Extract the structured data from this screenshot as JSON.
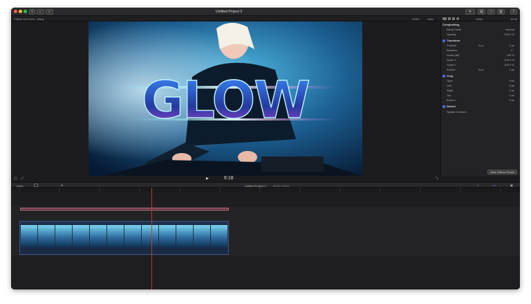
{
  "toolbar": {
    "project_title": "Untitled Project 3"
  },
  "subbar": {
    "library_label": "FINAL H.E.N.R.L. Shiny",
    "zoom": "143%",
    "view_label": "View",
    "inspector_tab": "Video",
    "inspector_right": "10:18"
  },
  "viewer": {
    "title_text": "GLOW"
  },
  "inspector": {
    "compositing": "Compositing",
    "blend_mode_label": "Blend Mode",
    "blend_mode_value": "Normal",
    "opacity_label": "Opacity",
    "opacity_value": "100.0 %",
    "transform": "Transform",
    "position_label": "Position",
    "position_x": "0 px",
    "position_y": "0 px",
    "rotation_label": "Rotation",
    "rotation_value": "0 °",
    "scale_all_label": "Scale (All)",
    "scale_all_value": "100 %",
    "scale_x_label": "Scale X",
    "scale_x_value": "100.0 %",
    "scale_y_label": "Scale Y",
    "scale_y_value": "100.0 %",
    "anchor_label": "Anchor",
    "anchor_x": "0 px",
    "anchor_y": "0 px",
    "crop": "Crop",
    "type_label": "Type",
    "type_value": "Trim",
    "left_label": "Left",
    "left_value": "0 px",
    "right_label": "Right",
    "right_value": "0 px",
    "top_label": "Top",
    "top_value": "0 px",
    "bottom_label": "Bottom",
    "bottom_value": "0 px",
    "distort": "Distort",
    "spatial_conform": "Spatial Conform",
    "save_preset": "Save Effects Preset"
  },
  "viewer_controls": {
    "timecode": "6:18"
  },
  "timeline_bar": {
    "index_label": "Index",
    "project_label": "Untitled Project 3",
    "duration": "00:01 / 00:14"
  }
}
